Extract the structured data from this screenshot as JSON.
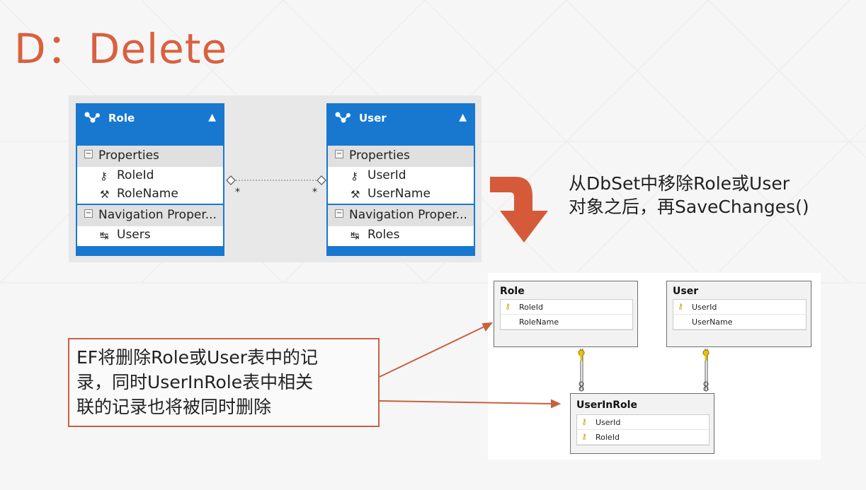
{
  "title": "D：Delete",
  "ef_diagram": {
    "role": {
      "name": "Role",
      "properties_header": "Properties",
      "properties": [
        "RoleId",
        "RoleName"
      ],
      "nav_header": "Navigation Proper...",
      "nav": [
        "Users"
      ]
    },
    "user": {
      "name": "User",
      "properties_header": "Properties",
      "properties": [
        "UserId",
        "UserName"
      ],
      "nav_header": "Navigation Proper...",
      "nav": [
        "Roles"
      ]
    },
    "multiplicity_left": "*",
    "multiplicity_right": "*"
  },
  "note_top": [
    "从DbSet中移除Role或User",
    "对象之后，再SaveChanges()"
  ],
  "db_diagram": {
    "role_table": {
      "name": "Role",
      "columns": [
        "RoleId",
        "RoleName"
      ]
    },
    "user_table": {
      "name": "User",
      "columns": [
        "UserId",
        "UserName"
      ]
    },
    "userinrole_table": {
      "name": "UserInRole",
      "columns": [
        "UserId",
        "RoleId"
      ]
    }
  },
  "callout": [
    "EF将删除Role或User表中的记",
    "录，同时UserInRole表中相关",
    "联的记录也将被同时删除"
  ],
  "colors": {
    "accent": "#d9603f",
    "ef_blue": "#1878d0",
    "arrow": "#d55a3a"
  }
}
